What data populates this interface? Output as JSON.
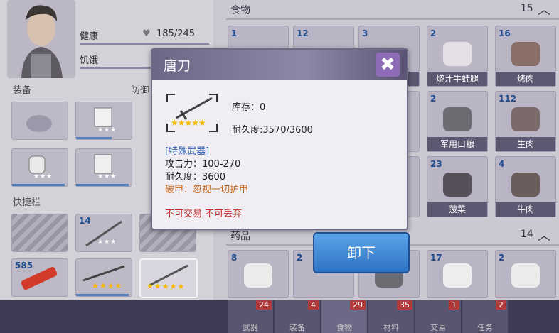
{
  "character": {
    "health_label": "健康",
    "health_value": "185/245",
    "hunger_label": "饥饿"
  },
  "left": {
    "equip_title": "装备",
    "defense_title": "防御",
    "quick_title": "快捷栏",
    "quick_counts": [
      "14",
      "585"
    ]
  },
  "food": {
    "title": "食物",
    "count": "15",
    "items": [
      {
        "count": "1",
        "name": ""
      },
      {
        "count": "12",
        "name": ""
      },
      {
        "count": "3",
        "name": "肉"
      },
      {
        "count": "2",
        "name": "烧汁牛蛙腿"
      },
      {
        "count": "16",
        "name": "烤肉"
      },
      {
        "count": "2",
        "name": "军用口粮"
      },
      {
        "count": "112",
        "name": "生肉"
      },
      {
        "count": "23",
        "name": "菠菜"
      },
      {
        "count": "4",
        "name": "牛肉"
      }
    ]
  },
  "medicine": {
    "title": "药品",
    "count": "14",
    "items": [
      {
        "count": "8"
      },
      {
        "count": "2"
      },
      {
        "count": "17"
      },
      {
        "count": "2"
      }
    ]
  },
  "tabs": [
    {
      "badge": "24",
      "label": "武器"
    },
    {
      "badge": "4",
      "label": "装备"
    },
    {
      "badge": "29",
      "label": "食物"
    },
    {
      "badge": "35",
      "label": "材料"
    },
    {
      "badge": "1",
      "label": "交易"
    },
    {
      "badge": "2",
      "label": "任务"
    }
  ],
  "modal": {
    "title": "唐刀",
    "stock": "库存：0",
    "durability_line": "耐久度:3570/3600",
    "stars": "★★★★★",
    "category": "[特殊武器]",
    "attack": "攻击力：100-270",
    "durability": "耐久度：3600",
    "armor_break": "破甲：忽视一切护甲",
    "restriction": "不可交易 不可丢弃",
    "close_symbol": "✖"
  },
  "unequip_label": "卸下",
  "colors": {
    "accent_blue": "#3a86d6",
    "restriction_red": "#c22b2b",
    "category_blue": "#2f5fb5",
    "armor_orange": "#c4661a"
  }
}
